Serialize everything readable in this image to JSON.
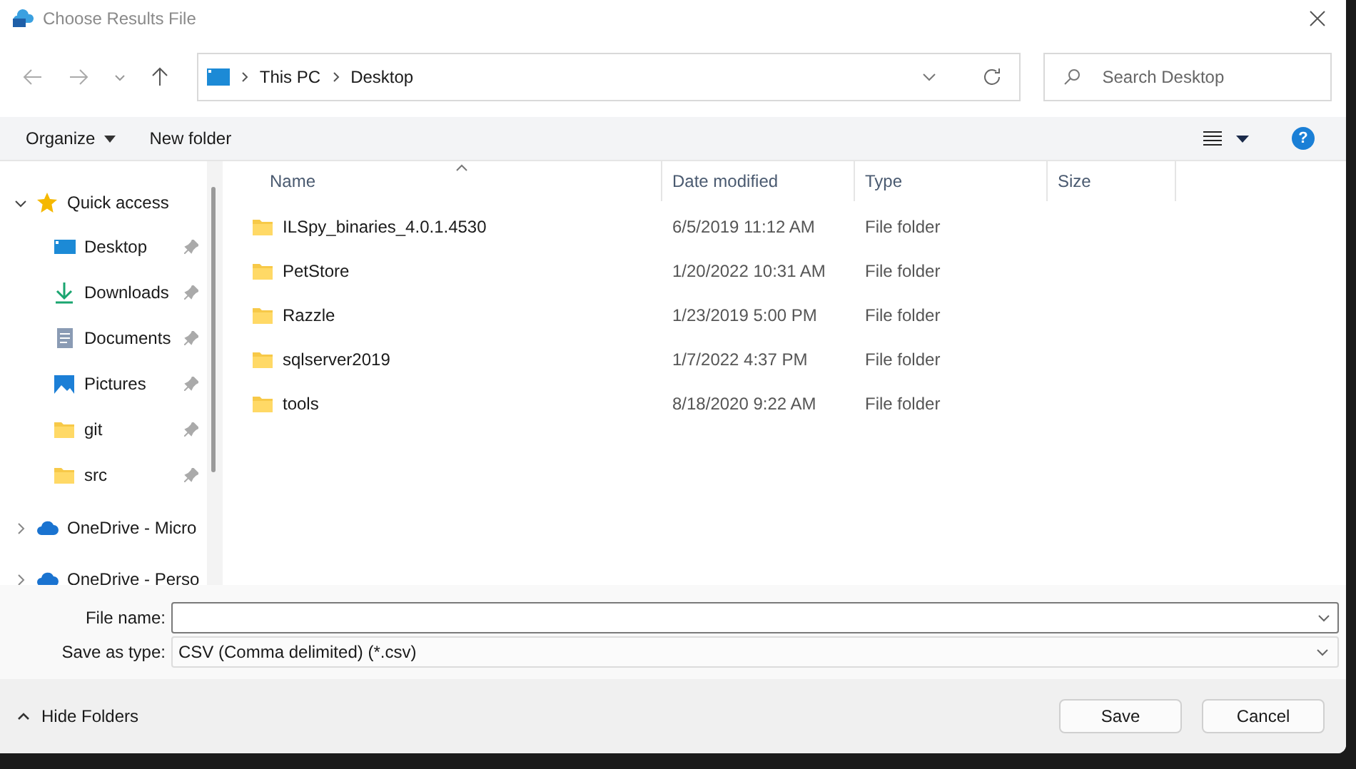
{
  "window": {
    "title": "Choose Results File"
  },
  "address": {
    "crumbs": [
      "This PC",
      "Desktop"
    ]
  },
  "search": {
    "placeholder": "Search Desktop"
  },
  "command_bar": {
    "organize": "Organize",
    "new_folder": "New folder",
    "help": "?"
  },
  "sidebar": {
    "items": [
      {
        "label": "Quick access",
        "kind": "star",
        "expanded": true,
        "children": [
          {
            "label": "Desktop",
            "kind": "desktop",
            "pinned": true
          },
          {
            "label": "Downloads",
            "kind": "download",
            "pinned": true
          },
          {
            "label": "Documents",
            "kind": "document",
            "pinned": true
          },
          {
            "label": "Pictures",
            "kind": "picture",
            "pinned": true
          },
          {
            "label": "git",
            "kind": "folder",
            "pinned": true
          },
          {
            "label": "src",
            "kind": "folder",
            "pinned": true
          }
        ]
      },
      {
        "label": "OneDrive - Micro",
        "kind": "cloud",
        "expanded": false
      },
      {
        "label": "OneDrive - Perso",
        "kind": "cloud",
        "expanded": false
      }
    ]
  },
  "table": {
    "columns": [
      {
        "label": "Name",
        "sorted": true
      },
      {
        "label": "Date modified",
        "sorted": false
      },
      {
        "label": "Type",
        "sorted": false
      },
      {
        "label": "Size",
        "sorted": false
      }
    ],
    "rows": [
      {
        "name": "ILSpy_binaries_4.0.1.4530",
        "date": "6/5/2019 11:12 AM",
        "type": "File folder"
      },
      {
        "name": "PetStore",
        "date": "1/20/2022 10:31 AM",
        "type": "File folder"
      },
      {
        "name": "Razzle",
        "date": "1/23/2019 5:00 PM",
        "type": "File folder"
      },
      {
        "name": "sqlserver2019",
        "date": "1/7/2022 4:37 PM",
        "type": "File folder"
      },
      {
        "name": "tools",
        "date": "8/18/2020 9:22 AM",
        "type": "File folder"
      }
    ]
  },
  "form": {
    "file_name_label": "File name:",
    "type_label": "Save as type:",
    "type_value": "CSV (Comma delimited) (*.csv)"
  },
  "footer": {
    "hide_folders": "Hide Folders",
    "buttons": [
      "Save",
      "Cancel"
    ]
  }
}
